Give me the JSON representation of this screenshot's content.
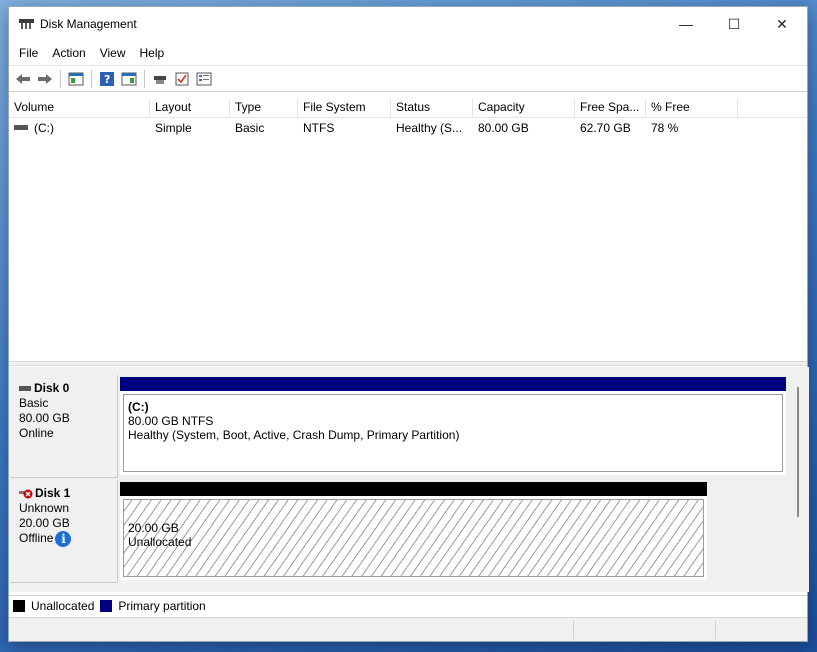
{
  "window": {
    "title": "Disk Management",
    "controls": {
      "minimize": "—",
      "maximize": "☐",
      "close": "✕"
    }
  },
  "menu": [
    "File",
    "Action",
    "View",
    "Help"
  ],
  "toolbar": {
    "icons": [
      "back-icon",
      "forward-icon",
      "console-tree-icon",
      "help-icon",
      "action-pane-icon",
      "connect-icon",
      "checklist-icon",
      "properties-icon"
    ]
  },
  "volume_list": {
    "columns": [
      "Volume",
      "Layout",
      "Type",
      "File System",
      "Status",
      "Capacity",
      "Free Spa...",
      "% Free"
    ],
    "rows": [
      {
        "volume": "(C:)",
        "layout": "Simple",
        "type": "Basic",
        "file_system": "NTFS",
        "status": "Healthy (S...",
        "capacity": "80.00 GB",
        "free_space": "62.70 GB",
        "pct_free": "78 %"
      }
    ]
  },
  "disks": [
    {
      "name": "Disk 0",
      "type": "Basic",
      "size": "80.00 GB",
      "state": "Online",
      "partition": {
        "label": "(C:)",
        "size_fs": "80.00 GB NTFS",
        "status": "Healthy (System, Boot, Active, Crash Dump, Primary Partition)"
      }
    },
    {
      "name": "Disk 1",
      "type": "Unknown",
      "size": "20.00 GB",
      "state": "Offline",
      "partition": {
        "size": "20.00 GB",
        "status": "Unallocated"
      }
    }
  ],
  "legend": [
    {
      "label": "Unallocated",
      "color": "#000000"
    },
    {
      "label": "Primary partition",
      "color": "#00007f"
    }
  ],
  "colors": {
    "primary_partition": "#00007f",
    "unallocated": "#000000",
    "offline_badge": "#cc0000",
    "info_badge": "#1b6fd6"
  }
}
